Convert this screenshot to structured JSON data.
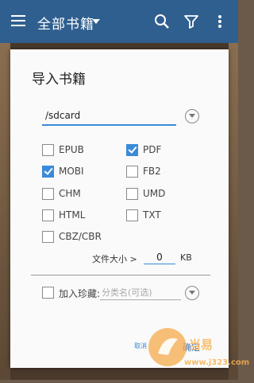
{
  "appbar": {
    "title": "全部书籍",
    "menu_icon": "menu-icon",
    "search_icon": "search-icon",
    "filter_icon": "filter-icon",
    "overflow_icon": "more-vert-icon",
    "color": "#2f5f8f"
  },
  "dialog": {
    "title": "导入书籍",
    "path_value": "/sdcard",
    "formats": [
      {
        "label": "EPUB",
        "checked": false
      },
      {
        "label": "PDF",
        "checked": true
      },
      {
        "label": "MOBI",
        "checked": true
      },
      {
        "label": "FB2",
        "checked": false
      },
      {
        "label": "CHM",
        "checked": false
      },
      {
        "label": "UMD",
        "checked": false
      },
      {
        "label": "HTML",
        "checked": false
      },
      {
        "label": "TXT",
        "checked": false
      },
      {
        "label": "CBZ/CBR",
        "checked": false
      }
    ],
    "size_label": "文件大小 >",
    "size_value": "0",
    "size_unit": "KB",
    "collect_label": "加入珍藏:",
    "collect_checked": false,
    "category_placeholder": "分类名(可选)",
    "cancel_label": "取消",
    "ok_label": "确定",
    "accent": "#3a8ad8"
  },
  "watermark": {
    "site": "www.j323.com"
  }
}
